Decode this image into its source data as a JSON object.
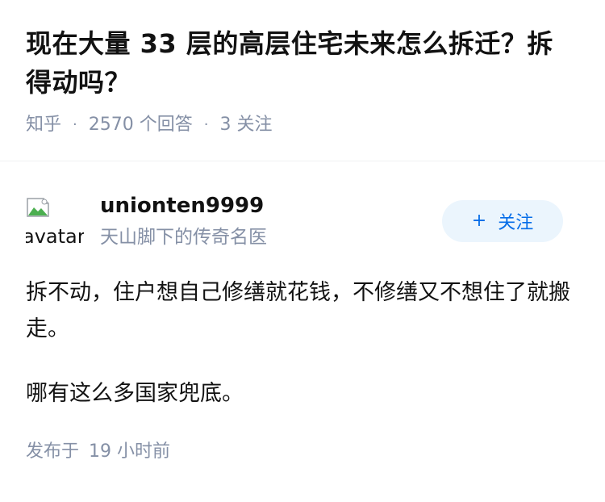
{
  "question": {
    "title": "现在大量 33 层的高层住宅未来怎么拆迁？拆得动吗？",
    "source": "知乎",
    "separator": "·",
    "answers_count": "2570 个回答",
    "followers_count": "3 关注"
  },
  "answer": {
    "author": {
      "avatar_alt": "avatar",
      "name": "unionten9999",
      "headline": "天山脚下的传奇名医"
    },
    "follow_button": {
      "icon": "+",
      "label": "关注"
    },
    "paragraphs": [
      "拆不动，住户想自己修缮就花钱，不修缮又不想住了就搬走。",
      "哪有这么多国家兜底。"
    ],
    "time": {
      "prefix": "发布于",
      "value": "19 小时前"
    }
  },
  "colors": {
    "title": "#121212",
    "meta": "#8590a6",
    "accent": "#056de8",
    "follow_bg": "#ebf5fd"
  },
  "icons": {
    "avatar": "broken-image-icon",
    "follow": "plus-icon"
  }
}
